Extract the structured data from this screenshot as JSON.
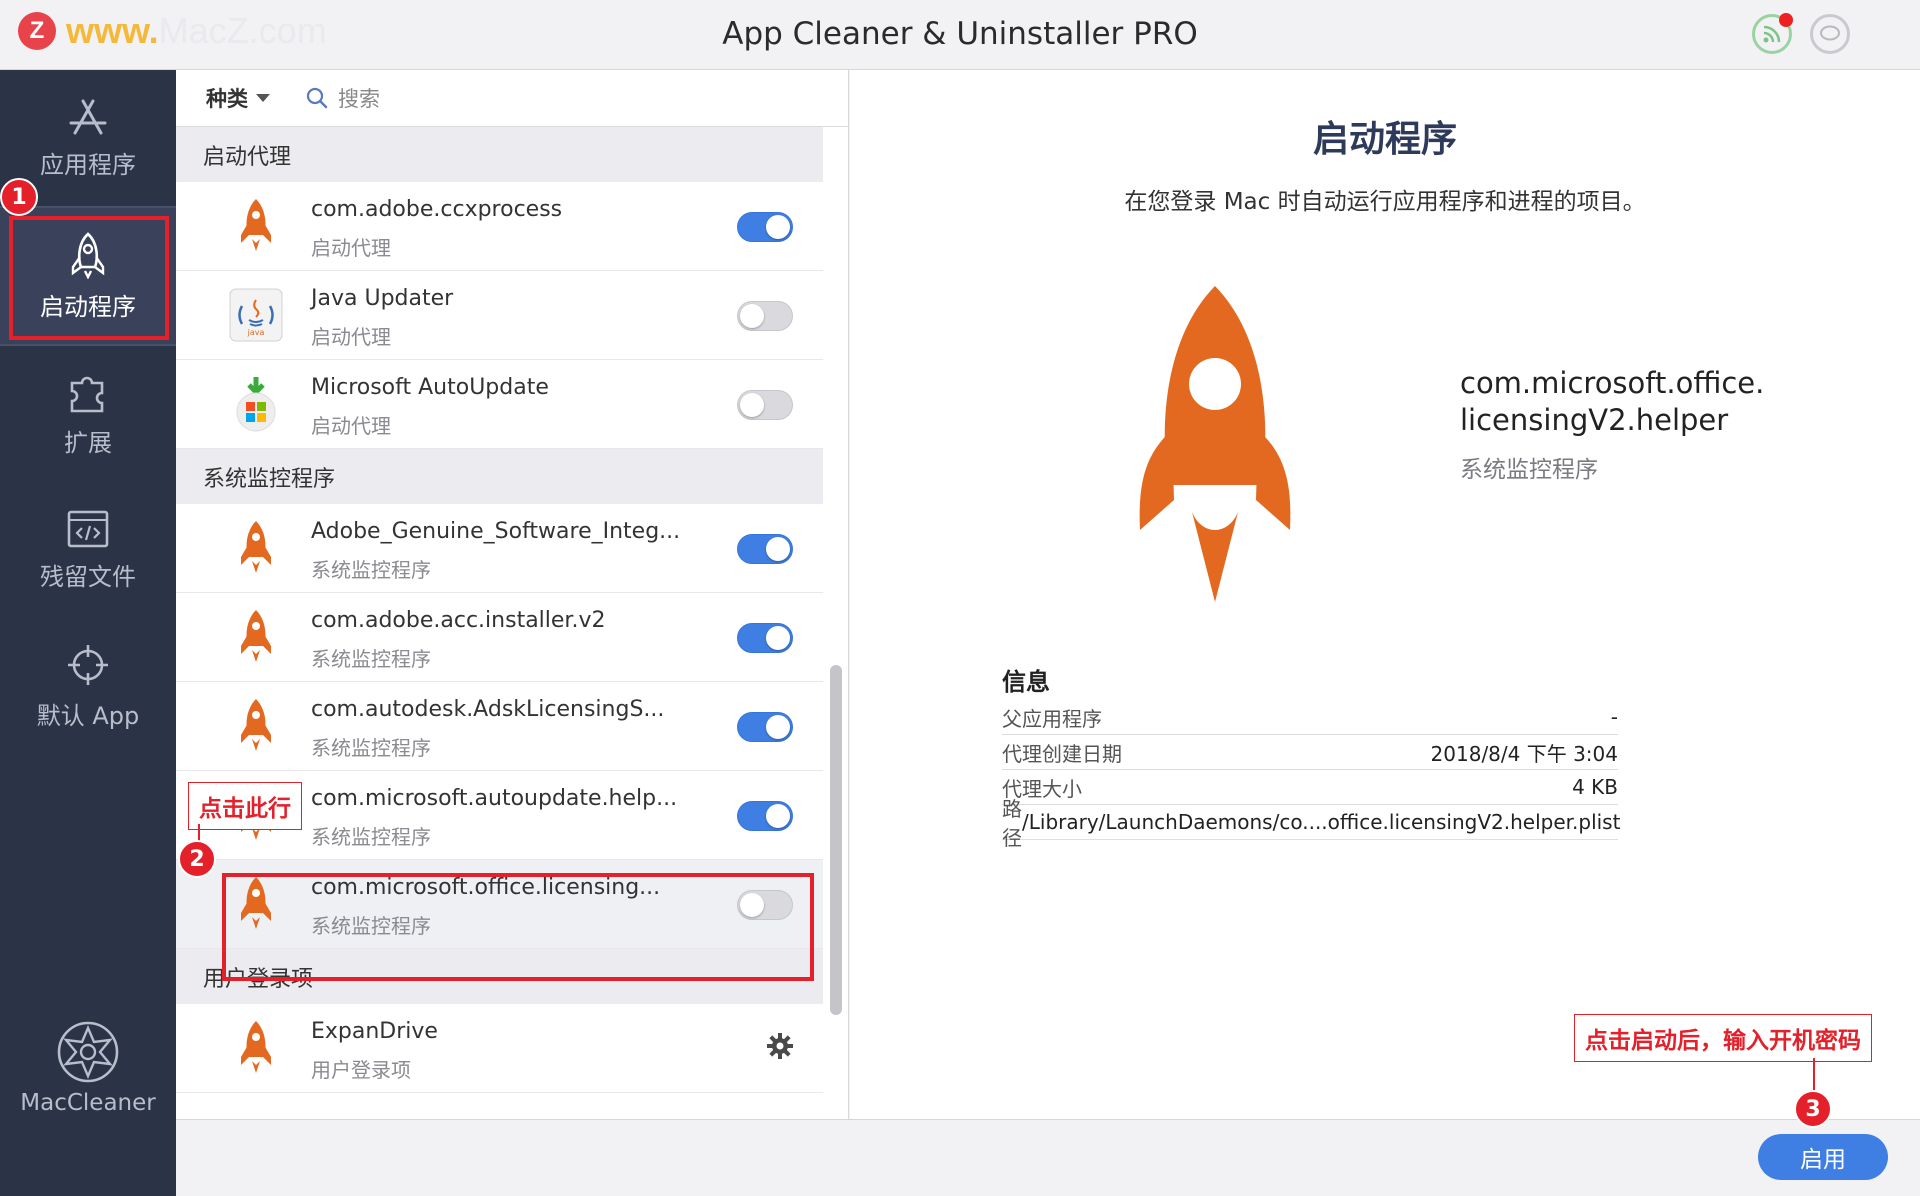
{
  "window": {
    "title": "App Cleaner & Uninstaller PRO",
    "watermark": {
      "logo": "Z",
      "www": "www.",
      "site": "MacZ.com"
    }
  },
  "sidebar": {
    "items": [
      {
        "label": "应用程序",
        "icon": "app-store-icon"
      },
      {
        "label": "启动程序",
        "icon": "rocket-icon",
        "active": true
      },
      {
        "label": "扩展",
        "icon": "puzzle-icon"
      },
      {
        "label": "残留文件",
        "icon": "code-file-icon"
      },
      {
        "label": "默认 App",
        "icon": "crosshair-icon"
      }
    ],
    "bottom_label": "MacCleaner"
  },
  "toolbar": {
    "category": "种类",
    "search_placeholder": "搜索"
  },
  "sections": [
    {
      "title": "启动代理",
      "items": [
        {
          "name": "com.adobe.ccxprocess",
          "type": "启动代理",
          "enabled": true
        },
        {
          "name": "Java Updater",
          "type": "启动代理",
          "enabled": false
        },
        {
          "name": "Microsoft AutoUpdate",
          "type": "启动代理",
          "enabled": false
        }
      ]
    },
    {
      "title": "系统监控程序",
      "items": [
        {
          "name": "Adobe_Genuine_Software_Integ...",
          "type": "系统监控程序",
          "enabled": true
        },
        {
          "name": "com.adobe.acc.installer.v2",
          "type": "系统监控程序",
          "enabled": true
        },
        {
          "name": "com.autodesk.AdskLicensingS...",
          "type": "系统监控程序",
          "enabled": true
        },
        {
          "name": "com.microsoft.autoupdate.help...",
          "type": "系统监控程序",
          "enabled": true
        },
        {
          "name": "com.microsoft.office.licensing...",
          "type": "系统监控程序",
          "enabled": false,
          "selected": true
        }
      ]
    },
    {
      "title": "用户登录项",
      "items": [
        {
          "name": "ExpanDrive",
          "type": "用户登录项"
        }
      ]
    }
  ],
  "detail": {
    "heading": "启动程序",
    "description": "在您登录 Mac 时自动运行应用程序和进程的项目。",
    "item_name_line1": "com.microsoft.office.",
    "item_name_line2": "licensingV2.helper",
    "item_type": "系统监控程序",
    "info_title": "信息",
    "info": [
      {
        "key": "父应用程序",
        "value": "-"
      },
      {
        "key": "代理创建日期",
        "value": "2018/8/4 下午 3:04"
      },
      {
        "key": "代理大小",
        "value": "4 KB"
      },
      {
        "key": "路径",
        "value": "/Library/LaunchDaemons/co....office.licensingV2.helper.plist"
      }
    ]
  },
  "enable_button": "启用",
  "annotations": {
    "badge1": "1",
    "badge2": "2",
    "badge3": "3",
    "callout_row": "点击此行",
    "callout_enable": "点击启动后，输入开机密码"
  },
  "colors": {
    "accent": "#3f7fe3",
    "sidebar": "#2b3347",
    "rocket": "#e2691f",
    "annotation": "#e4202a"
  }
}
